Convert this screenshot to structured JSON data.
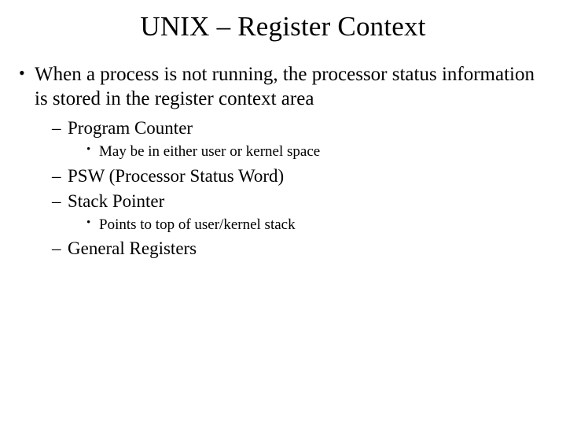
{
  "title": "UNIX – Register Context",
  "b1": "When a process is not running, the processor status information is stored in the register context area",
  "s1": "Program Counter",
  "s1a": "May be in either user or kernel space",
  "s2": "PSW (Processor Status Word)",
  "s3": "Stack Pointer",
  "s3a": "Points to top of user/kernel stack",
  "s4": "General Registers"
}
